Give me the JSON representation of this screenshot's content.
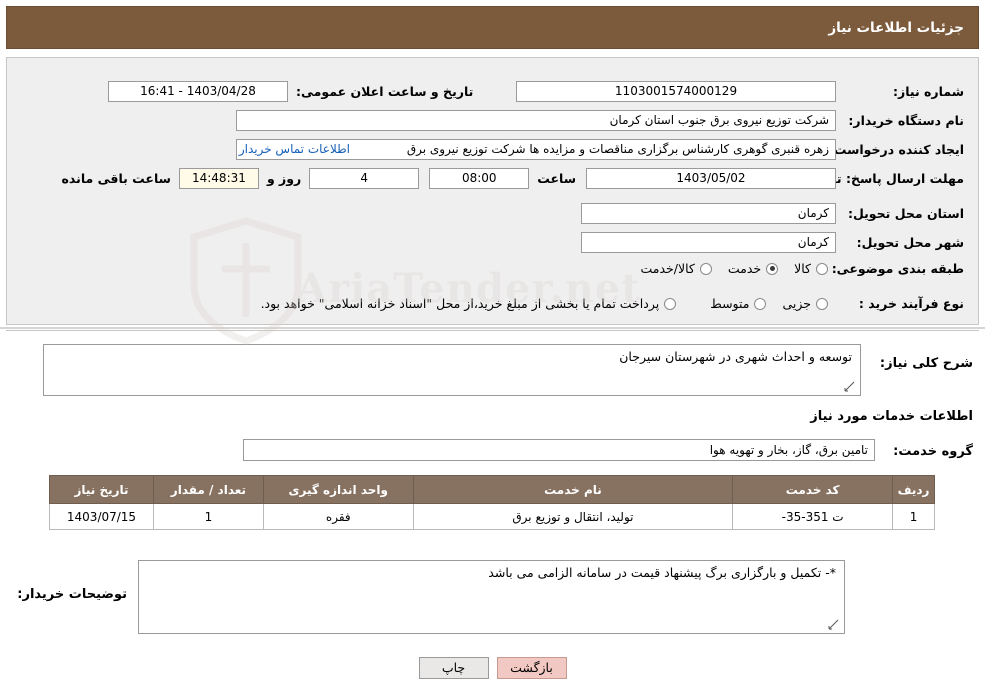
{
  "header": {
    "title": "جزئیات اطلاعات نیاز"
  },
  "form": {
    "need_number_label": "شماره نیاز:",
    "need_number_value": "1103001574000129",
    "announce_datetime_label": "تاریخ و ساعت اعلان عمومی:",
    "announce_datetime_value": "1403/04/28 - 16:41",
    "buyer_org_label": "نام دستگاه خریدار:",
    "buyer_org_value": "شرکت توزیع نیروی برق جنوب استان کرمان",
    "creator_label": "ایجاد کننده درخواست:",
    "creator_value": "زهره قنبری گوهری کارشناس برگزاری مناقصات و مزایده ها شرکت توزیع نیروی برق",
    "creator_link": "اطلاعات تماس خریدار",
    "deadline_label": "مهلت ارسال پاسخ: تا تاریخ:",
    "deadline_date": "1403/05/02",
    "deadline_hour_label": "ساعت",
    "deadline_hour_value": "08:00",
    "remaining_days_value": "4",
    "remaining_days_label": "روز و",
    "remaining_time_value": "14:48:31",
    "remaining_suffix": "ساعت باقی مانده",
    "province_label": "استان محل تحویل:",
    "province_value": "کرمان",
    "city_label": "شهر محل تحویل:",
    "city_value": "کرمان",
    "category_label": "طبقه بندی موضوعی:",
    "category_options": [
      "کالا",
      "خدمت",
      "کالا/خدمت"
    ],
    "category_selected": "خدمت",
    "process_label": "نوع فرآیند خرید :",
    "process_options": [
      "جزیی",
      "متوسط"
    ],
    "process_selected": "",
    "process_note": "پرداخت تمام یا بخشی از مبلغ خرید،از محل \"اسناد خزانه اسلامی\" خواهد بود."
  },
  "sections": {
    "general_need_label": "شرح کلی نیاز:",
    "general_need_value": "توسعه و احداث شهری در شهرستان سیرجان",
    "service_info_title": "اطلاعات خدمات مورد نیاز",
    "service_group_label": "گروه خدمت:",
    "service_group_value": "تامین برق، گاز، بخار و تهویه هوا",
    "buyer_notes_label": "توضیحات خریدار:",
    "buyer_notes_value": "*- تکمیل و بارگزاری برگ پیشنهاد قیمت در سامانه الزامی می باشد"
  },
  "table": {
    "columns": [
      "ردیف",
      "کد خدمت",
      "نام خدمت",
      "واحد اندازه گیری",
      "تعداد / مقدار",
      "تاریخ نیاز"
    ],
    "rows": [
      {
        "row": "1",
        "service_code": "ت 351-35-",
        "service_name": "تولید، انتقال و توزیع برق",
        "unit": "فقره",
        "quantity": "1",
        "need_date": "1403/07/15"
      }
    ]
  },
  "footer": {
    "print_label": "چاپ",
    "back_label": "بازگشت"
  },
  "watermark": {
    "text": "AriaTender.net"
  },
  "colors": {
    "header_bg": "#7c5a3c",
    "panel_bg": "#f0efef",
    "table_header_bg": "#877261",
    "link": "#1560b8",
    "back_button_bg": "#f2c9c2"
  }
}
